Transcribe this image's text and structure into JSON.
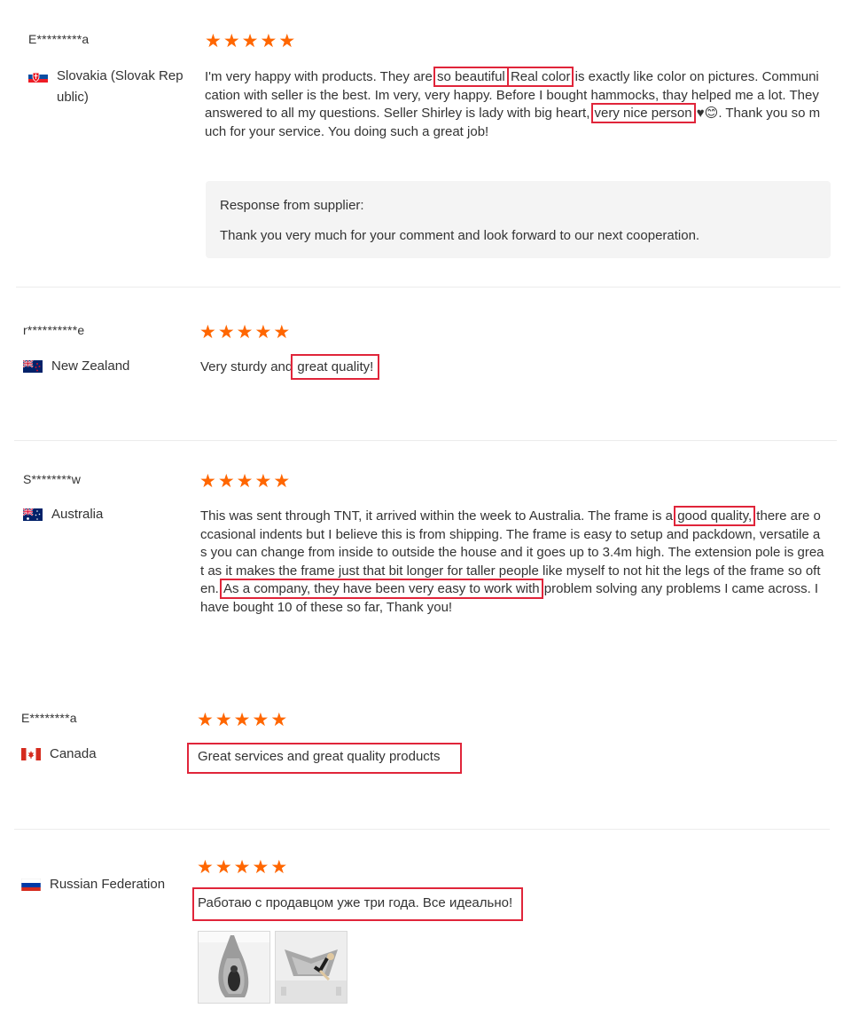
{
  "reviews": [
    {
      "buyer": "E*********a",
      "country": "Slovakia (Slovak Rep\nublic)",
      "rating": 5,
      "text_parts": [
        "I'm very happy with products. They are ",
        "so beautiful",
        " ",
        "Real color",
        " is exactly like color on pictures. Communication with seller is the best. Im very, very happy. Before I bought hammocks, thay helped me a lot. They answered to all my questions. Seller Shirley is lady with big heart, ",
        "very nice person",
        " ♥😊. Thank you so much for your service. You doing such a great job!"
      ],
      "response_title": "Response from supplier:",
      "response_text": "Thank you very much for your comment and look forward to our next cooperation."
    },
    {
      "buyer": "r**********e",
      "country": "New Zealand",
      "rating": 5,
      "text_parts": [
        "Very sturdy and ",
        "great quality!"
      ]
    },
    {
      "buyer": "S********w",
      "country": "Australia",
      "rating": 5,
      "text_parts": [
        "This was sent through TNT, it arrived within the week to Australia. The frame is a ",
        "good quality,",
        " there are occasional indents but I believe this is from shipping. The frame is easy to setup and packdown, versatile as you can change from inside to outside the house and it goes up to 3.4m high. The extension pole is great as it makes the frame just that bit longer for taller people like myself to not hit the legs of the frame so often. ",
        "As a company, they have been very easy to work with",
        " problem solving any problems I came across. I have bought 10 of these so far, Thank you!"
      ]
    },
    {
      "buyer": "E********a",
      "country": "Canada",
      "rating": 5,
      "text": "Great services and great quality products"
    },
    {
      "country": "Russian Federation",
      "rating": 5,
      "text": "Работаю с продавцом уже три года. Все идеально!",
      "photos": [
        "hammock-photo-1",
        "hammock-photo-2"
      ]
    }
  ],
  "icons": {
    "star": "★",
    "star_color": "#ff6600",
    "highlight_color": "#e0253a"
  }
}
